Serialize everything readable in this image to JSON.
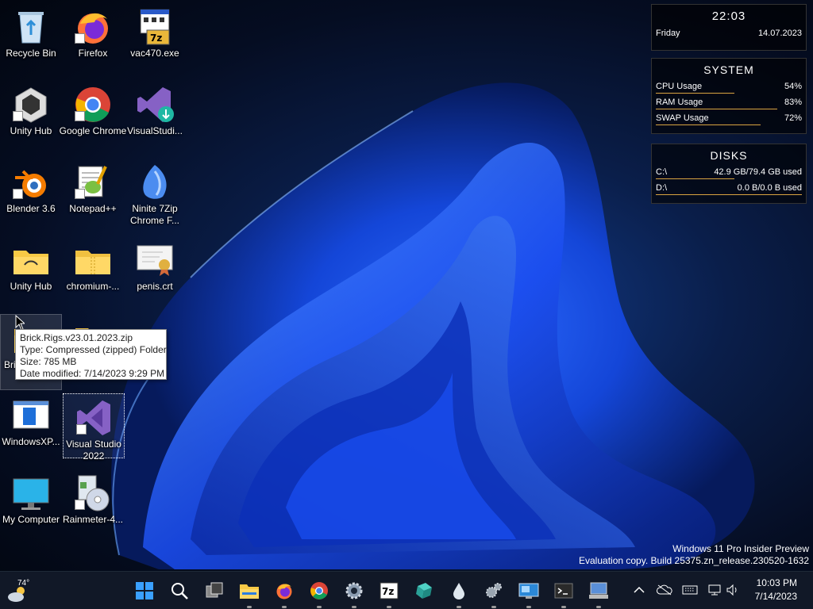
{
  "desktop_icons": [
    {
      "label": "Recycle Bin"
    },
    {
      "label": "Firefox"
    },
    {
      "label": "vac470.exe"
    },
    {
      "label": "Unity Hub"
    },
    {
      "label": "Google Chrome"
    },
    {
      "label": "VisualStudi..."
    },
    {
      "label": "Blender 3.6"
    },
    {
      "label": "Notepad++"
    },
    {
      "label": "Ninite 7Zip Chrome F..."
    },
    {
      "label": "Unity Hub"
    },
    {
      "label": "chromium-..."
    },
    {
      "label": "penis.crt"
    },
    {
      "label": "Bri"
    },
    {
      "label": ""
    },
    {
      "label": "WindowsXP..."
    },
    {
      "label": "Visual Studio 2022"
    },
    {
      "label": "My Computer"
    },
    {
      "label": "Rainmeter-4..."
    }
  ],
  "tooltip": {
    "name": "Brick.Rigs.v23.01.2023.zip",
    "type": "Type: Compressed (zipped) Folder",
    "size": "Size: 785 MB",
    "modified": "Date modified: 7/14/2023 9:29 PM"
  },
  "clock_widget": {
    "time": "22:03",
    "day": "Friday",
    "date": "14.07.2023"
  },
  "system_widget": {
    "title": "SYSTEM",
    "rows": [
      {
        "label": "CPU Usage",
        "value": "54%",
        "fraction": 0.54
      },
      {
        "label": "RAM Usage",
        "value": "83%",
        "fraction": 0.83
      },
      {
        "label": "SWAP Usage",
        "value": "72%",
        "fraction": 0.72
      }
    ]
  },
  "disks_widget": {
    "title": "DISKS",
    "rows": [
      {
        "label": "C:\\",
        "value": "42.9 GB/79.4 GB used",
        "fraction": 0.54
      },
      {
        "label": "D:\\",
        "value": "0.0 B/0.0 B used",
        "fraction": 1.0
      }
    ]
  },
  "watermark": {
    "line1": "Windows 11 Pro Insider Preview",
    "line2": "Evaluation copy. Build 25375.zn_release.230520-1632"
  },
  "taskbar": {
    "weather_temp": "74°",
    "clock_time": "10:03 PM",
    "clock_date": "7/14/2023",
    "apps": [
      "start-icon",
      "search-icon",
      "task-view-icon",
      "file-explorer-icon",
      "firefox-icon",
      "chrome-icon",
      "settings-icon",
      "7zip-icon",
      "app-icon",
      "drop-icon",
      "control-panel-icon",
      "rdp-icon",
      "terminal-icon",
      "computer-icon"
    ]
  },
  "colors": {
    "accent": "#1565ff",
    "bar": "#d9a441",
    "taskbar": "#111827"
  }
}
